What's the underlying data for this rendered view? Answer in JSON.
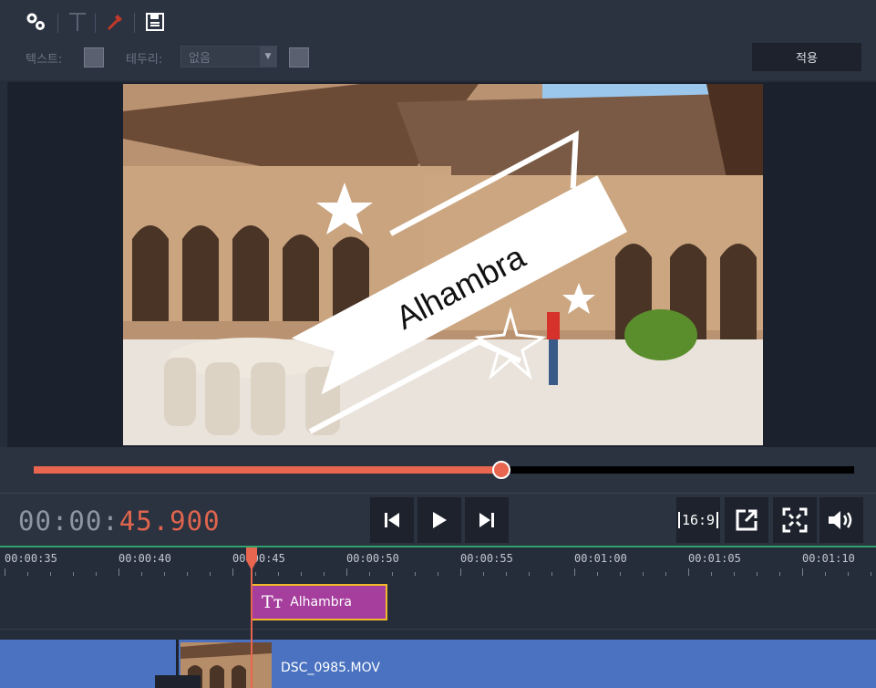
{
  "toolbar": {
    "icons": [
      "settings-icon",
      "text-icon",
      "eyedropper-icon",
      "save-icon"
    ],
    "text_label": "텍스트:",
    "border_label": "테두리:",
    "border_value": "없음",
    "apply_label": "적용"
  },
  "preview": {
    "banner_text": "Alhambra"
  },
  "seek": {
    "progress": 0.57
  },
  "playback": {
    "timecode_prefix": "00:00:",
    "timecode_value": "45.900",
    "aspect_label": "16:9"
  },
  "timeline": {
    "ruler_labels": [
      "00:00:35",
      "00:00:40",
      "00:00:45",
      "00:00:50",
      "00:00:55",
      "00:01:00",
      "00:01:05",
      "00:01:10"
    ],
    "text_clip_label": "Alhambra",
    "text_clip_icon": "Tт",
    "video_clip_label": "DSC_0985.MOV"
  },
  "colors": {
    "accent": "#e8664f",
    "text_clip": "#a53e9d",
    "text_clip_border": "#f0b92b",
    "video_track": "#4a72c0",
    "ruler_line": "#2fa36b"
  }
}
